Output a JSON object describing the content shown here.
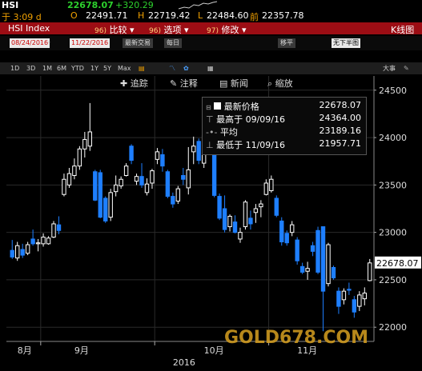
{
  "quote": {
    "ticker": "HSI",
    "last": "22678.07",
    "change": "+320.29",
    "time_label": "于 3:09 d",
    "open_label": "O",
    "open": "22491.71",
    "high_label": "H",
    "high": "22719.42",
    "low_label": "L",
    "low": "22484.60",
    "prev_label": "前",
    "prev": "22357.78"
  },
  "function_bar": {
    "security": "HSI Index",
    "menus": [
      {
        "num": "96)",
        "label": "比较"
      },
      {
        "num": "96)",
        "label": "选项"
      },
      {
        "num": "97)",
        "label": "修改"
      }
    ],
    "right_label": "K线图"
  },
  "date_row": {
    "start": "08/24/2016",
    "end": "11/22/2016",
    "last_trade": "最新交易",
    "frequency": "每日",
    "right_buttons": [
      "移平",
      "无下半图"
    ]
  },
  "period_row": {
    "periods": [
      "1D",
      "3D",
      "1M",
      "6M",
      "YTD",
      "1Y",
      "5Y",
      "Max"
    ],
    "right_label": "大事"
  },
  "chart_tools": [
    {
      "icon": "plus-icon",
      "label": "追踪"
    },
    {
      "icon": "pen-icon",
      "label": "注释"
    },
    {
      "icon": "news-icon",
      "label": "新闻"
    },
    {
      "icon": "zoom-icon",
      "label": "缩放"
    }
  ],
  "legend": {
    "rows": [
      {
        "icon": "square-icon",
        "label": "最新价格",
        "value": "22678.07"
      },
      {
        "icon": "high-marker-icon",
        "label": "最高于 09/09/16",
        "value": "24364.00"
      },
      {
        "icon": "avg-marker-icon",
        "label": "平均",
        "value": "23189.16"
      },
      {
        "icon": "low-marker-icon",
        "label": "最低于 11/09/16",
        "value": "21957.71"
      }
    ]
  },
  "colors": {
    "up": "#ffffff",
    "down": "#1e7fff",
    "price_tag": "#ffffff",
    "function_bar": "#9c0d14"
  },
  "watermark": "GOLD678.COM",
  "chart_data": {
    "type": "candlestick",
    "ylim": [
      21850,
      24650
    ],
    "yticks": [
      22000,
      22500,
      23000,
      23500,
      24000,
      24500
    ],
    "month_labels": [
      "8月",
      "9月",
      "10月",
      "11月"
    ],
    "year_label": "2016",
    "last_price_label": "22678.07",
    "candles": [
      {
        "o": 22810,
        "h": 22920,
        "l": 22720,
        "c": 22740
      },
      {
        "o": 22730,
        "h": 22900,
        "l": 22700,
        "c": 22860
      },
      {
        "o": 22820,
        "h": 22880,
        "l": 22730,
        "c": 22760
      },
      {
        "o": 22780,
        "h": 22900,
        "l": 22760,
        "c": 22870
      },
      {
        "o": 22930,
        "h": 23030,
        "l": 22860,
        "c": 22880
      },
      {
        "o": 22880,
        "h": 22930,
        "l": 22800,
        "c": 22890
      },
      {
        "o": 22880,
        "h": 22990,
        "l": 22850,
        "c": 22950
      },
      {
        "o": 22880,
        "h": 22960,
        "l": 22870,
        "c": 22940
      },
      {
        "o": 22950,
        "h": 23120,
        "l": 22940,
        "c": 23090
      },
      {
        "o": 23080,
        "h": 23170,
        "l": 22980,
        "c": 23020
      },
      {
        "o": 23400,
        "h": 23620,
        "l": 23380,
        "c": 23560
      },
      {
        "o": 23500,
        "h": 23680,
        "l": 23470,
        "c": 23620
      },
      {
        "o": 23600,
        "h": 23780,
        "l": 23560,
        "c": 23700
      },
      {
        "o": 23700,
        "h": 23910,
        "l": 23660,
        "c": 23880
      },
      {
        "o": 23880,
        "h": 24060,
        "l": 23790,
        "c": 23980
      },
      {
        "o": 23910,
        "h": 24364,
        "l": 23860,
        "c": 24060
      },
      {
        "o": 23640,
        "h": 23660,
        "l": 23330,
        "c": 23340
      },
      {
        "o": 23630,
        "h": 23660,
        "l": 23150,
        "c": 23160
      },
      {
        "o": 23360,
        "h": 23380,
        "l": 23100,
        "c": 23120
      },
      {
        "o": 23160,
        "h": 23460,
        "l": 23120,
        "c": 23420
      },
      {
        "o": 23430,
        "h": 23600,
        "l": 23380,
        "c": 23500
      },
      {
        "o": 23490,
        "h": 23590,
        "l": 23460,
        "c": 23560
      },
      {
        "o": 23600,
        "h": 23730,
        "l": 23590,
        "c": 23700
      },
      {
        "o": 23910,
        "h": 23930,
        "l": 23720,
        "c": 23760
      },
      {
        "o": 23540,
        "h": 23620,
        "l": 23500,
        "c": 23590
      },
      {
        "o": 23590,
        "h": 23730,
        "l": 23470,
        "c": 23500
      },
      {
        "o": 23420,
        "h": 23570,
        "l": 23390,
        "c": 23510
      },
      {
        "o": 23520,
        "h": 23670,
        "l": 23460,
        "c": 23650
      },
      {
        "o": 23770,
        "h": 23890,
        "l": 23720,
        "c": 23850
      },
      {
        "o": 23820,
        "h": 23880,
        "l": 23640,
        "c": 23700
      },
      {
        "o": 23640,
        "h": 23660,
        "l": 23360,
        "c": 23380
      },
      {
        "o": 23380,
        "h": 23420,
        "l": 23260,
        "c": 23300
      },
      {
        "o": 23330,
        "h": 23490,
        "l": 23300,
        "c": 23460
      },
      {
        "o": 23600,
        "h": 23680,
        "l": 23500,
        "c": 23560
      },
      {
        "o": 23470,
        "h": 23900,
        "l": 23400,
        "c": 23660
      },
      {
        "o": 23850,
        "h": 24010,
        "l": 23720,
        "c": 23910
      },
      {
        "o": 23960,
        "h": 23990,
        "l": 23720,
        "c": 23760
      },
      {
        "o": 23730,
        "h": 24060,
        "l": 23680,
        "c": 24020
      },
      {
        "o": 24000,
        "h": 24180,
        "l": 23830,
        "c": 23880
      },
      {
        "o": 23860,
        "h": 23890,
        "l": 23370,
        "c": 23390
      },
      {
        "o": 23380,
        "h": 23410,
        "l": 23130,
        "c": 23150
      },
      {
        "o": 23250,
        "h": 23390,
        "l": 23000,
        "c": 23030
      },
      {
        "o": 23060,
        "h": 23190,
        "l": 23010,
        "c": 23170
      },
      {
        "o": 23110,
        "h": 23180,
        "l": 22990,
        "c": 23000
      },
      {
        "o": 22930,
        "h": 23050,
        "l": 22890,
        "c": 23000
      },
      {
        "o": 23060,
        "h": 23340,
        "l": 23030,
        "c": 23320
      },
      {
        "o": 23150,
        "h": 23230,
        "l": 23030,
        "c": 23090
      },
      {
        "o": 23210,
        "h": 23300,
        "l": 23100,
        "c": 23250
      },
      {
        "o": 23270,
        "h": 23340,
        "l": 23160,
        "c": 23300
      },
      {
        "o": 23400,
        "h": 23560,
        "l": 23390,
        "c": 23520
      },
      {
        "o": 23440,
        "h": 23600,
        "l": 23420,
        "c": 23560
      },
      {
        "o": 23360,
        "h": 23390,
        "l": 23160,
        "c": 23180
      },
      {
        "o": 23120,
        "h": 23160,
        "l": 22860,
        "c": 22900
      },
      {
        "o": 22990,
        "h": 23020,
        "l": 22860,
        "c": 22890
      },
      {
        "o": 23000,
        "h": 23120,
        "l": 22960,
        "c": 23080
      },
      {
        "o": 22920,
        "h": 22950,
        "l": 22660,
        "c": 22700
      },
      {
        "o": 22640,
        "h": 22680,
        "l": 22560,
        "c": 22580
      },
      {
        "o": 22590,
        "h": 22690,
        "l": 22500,
        "c": 22620
      },
      {
        "o": 22860,
        "h": 22900,
        "l": 22750,
        "c": 22800
      },
      {
        "o": 23020,
        "h": 23060,
        "l": 22560,
        "c": 22580
      },
      {
        "o": 23060,
        "h": 23060,
        "l": 21957.71,
        "c": 22380
      },
      {
        "o": 22460,
        "h": 22890,
        "l": 22430,
        "c": 22870
      },
      {
        "o": 22630,
        "h": 22650,
        "l": 22500,
        "c": 22520
      },
      {
        "o": 22380,
        "h": 22420,
        "l": 22140,
        "c": 22220
      },
      {
        "o": 22290,
        "h": 22410,
        "l": 22240,
        "c": 22380
      },
      {
        "o": 22400,
        "h": 22470,
        "l": 22340,
        "c": 22390
      },
      {
        "o": 22290,
        "h": 22330,
        "l": 22100,
        "c": 22160
      },
      {
        "o": 22220,
        "h": 22380,
        "l": 22170,
        "c": 22340
      },
      {
        "o": 22300,
        "h": 22420,
        "l": 22230,
        "c": 22360
      },
      {
        "o": 22491.71,
        "h": 22719.42,
        "l": 22484.6,
        "c": 22678.07
      }
    ]
  }
}
